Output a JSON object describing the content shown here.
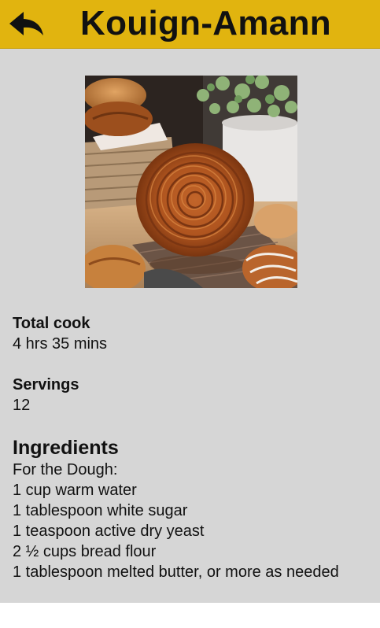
{
  "header": {
    "title": "Kouign-Amann",
    "back_icon": "back-arrow-icon",
    "background_color": "#e1b40f"
  },
  "recipe": {
    "photo_description_icon": "recipe-photo",
    "total_cook": {
      "label": "Total cook",
      "value": "4 hrs 35 mins"
    },
    "servings": {
      "label": "Servings",
      "value": "12"
    },
    "ingredients": {
      "heading": "Ingredients",
      "items": [
        "For the Dough:",
        "1 cup warm water",
        "1 tablespoon white sugar",
        "1 teaspoon active dry yeast",
        "2 ½ cups bread flour",
        "1 tablespoon melted butter, or more as needed"
      ]
    }
  },
  "colors": {
    "content_background": "#d6d6d6",
    "text": "#111111"
  }
}
